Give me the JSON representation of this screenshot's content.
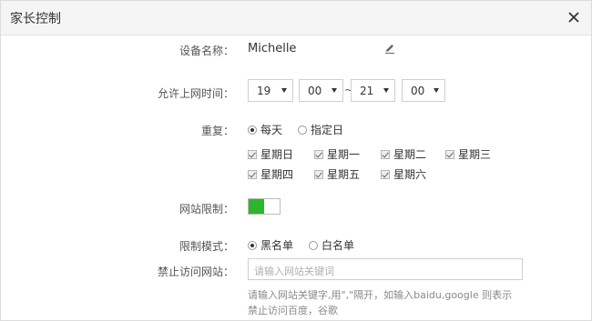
{
  "dialog": {
    "title": "家长控制"
  },
  "device": {
    "label": "设备名称：",
    "name": "Michelle"
  },
  "time": {
    "label": "允许上网时间：",
    "start_hour": "19",
    "start_minute": "00",
    "separator": "~",
    "end_hour": "21",
    "end_minute": "00"
  },
  "repeat": {
    "label": "重复：",
    "options": [
      "每天",
      "指定日"
    ],
    "selected": "每天",
    "days": [
      "星期日",
      "星期一",
      "星期二",
      "星期三",
      "星期四",
      "星期五",
      "星期六"
    ]
  },
  "site_limit": {
    "label": "网站限制：",
    "enabled": true
  },
  "mode": {
    "label": "限制模式：",
    "options": [
      "黑名单",
      "白名单"
    ],
    "selected": "黑名单"
  },
  "blocked_sites": {
    "label": "禁止访问网站：",
    "placeholder": "请输入网站关键词",
    "hint": "请输入网站关键字,用\",\"隔开，如输入baidu,google 则表示禁止访问百度，谷歌"
  },
  "colors": {
    "toggle_on": "#2db52d",
    "titlebar": "#f5f5f5"
  }
}
